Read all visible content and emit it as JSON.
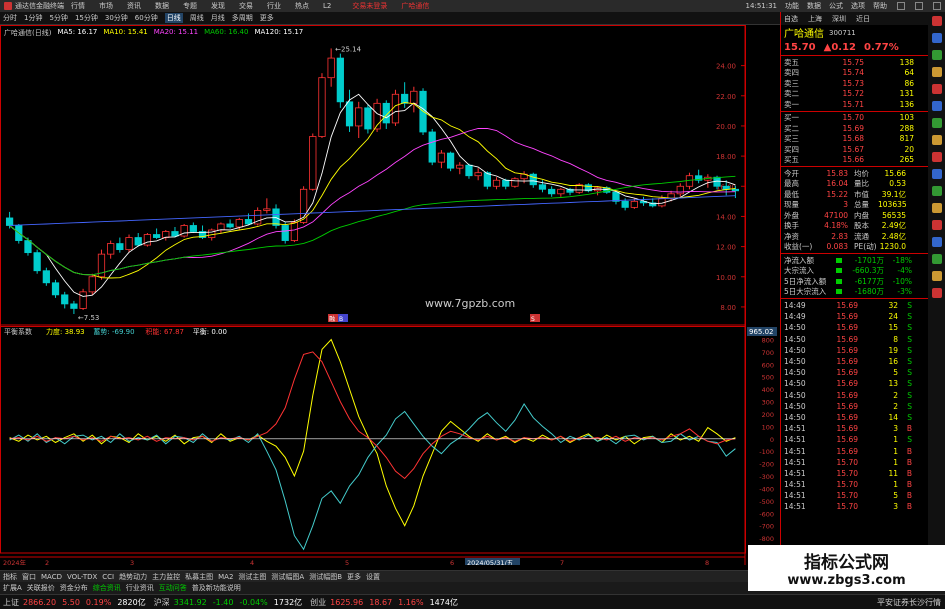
{
  "window": {
    "app_title": "通达信金融终端",
    "menus": [
      "行情",
      "市场",
      "资讯",
      "数据",
      "专题",
      "发现",
      "交易",
      "行业",
      "热点",
      "L2"
    ],
    "center_links": [
      "交易未登录",
      "广哈通信"
    ],
    "right_menus": [
      "功能",
      "数据",
      "公式",
      "选项",
      "帮助"
    ],
    "clock": "14:51:31"
  },
  "period_tabs": [
    "分时",
    "1分钟",
    "5分钟",
    "15分钟",
    "30分钟",
    "60分钟",
    "日线",
    "周线",
    "月线",
    "多周期",
    "更多"
  ],
  "active_period": "日线",
  "chart_header": {
    "stock": "广哈通信(日线)",
    "ma": [
      {
        "label": "MA5: 16.17",
        "color": "#ffffff"
      },
      {
        "label": "MA10: 15.41",
        "color": "#ffff00"
      },
      {
        "label": "MA20: 15.11",
        "color": "#ff44ff"
      },
      {
        "label": "MA60: 16.40",
        "color": "#00cc00"
      },
      {
        "label": "MA120: 15.17",
        "color": "#ffffff"
      }
    ],
    "high_label": "25.14",
    "low_label": "7.53",
    "site": "www.7gpzb.com"
  },
  "indicator_header": {
    "name": "平衡系数",
    "items": [
      {
        "label": "力度: 38.93",
        "color": "#ffff00"
      },
      {
        "label": "蓄势: -69.90",
        "color": "#44cccc"
      },
      {
        "label": "积能: 67.87",
        "color": "#ff3333"
      },
      {
        "label": "平衡: 0.00",
        "color": "#ffffff"
      }
    ],
    "cursor_value": "965.02"
  },
  "price_axis": [
    "24.00",
    "22.00",
    "20.00",
    "18.00",
    "16.00",
    "14.00",
    "12.00",
    "10.00",
    "8.00"
  ],
  "ind_axis": [
    "800",
    "700",
    "600",
    "500",
    "400",
    "300",
    "200",
    "100",
    "0",
    "-100",
    "-200",
    "-300",
    "-400",
    "-500",
    "-600",
    "-700",
    "-800",
    "-900"
  ],
  "date_axis": {
    "ticks": [
      "2024年",
      "2",
      "3",
      "4",
      "5",
      "6",
      "7",
      "8"
    ],
    "cursor": "2024/05/31/五"
  },
  "markers": [
    "融",
    "B",
    "S"
  ],
  "right_panel": {
    "header": [
      "自选",
      "上海",
      "深圳",
      "近日"
    ],
    "stock_name": "广哈通信",
    "stock_code": "300711",
    "price": "15.70",
    "change": "▲0.12",
    "pct": "0.77%",
    "asks": [
      {
        "l": "卖五",
        "p": "15.75",
        "v": "138"
      },
      {
        "l": "卖四",
        "p": "15.74",
        "v": "64"
      },
      {
        "l": "卖三",
        "p": "15.73",
        "v": "86"
      },
      {
        "l": "卖二",
        "p": "15.72",
        "v": "131"
      },
      {
        "l": "卖一",
        "p": "15.71",
        "v": "136"
      }
    ],
    "bids": [
      {
        "l": "买一",
        "p": "15.70",
        "v": "103"
      },
      {
        "l": "买二",
        "p": "15.69",
        "v": "288"
      },
      {
        "l": "买三",
        "p": "15.68",
        "v": "817"
      },
      {
        "l": "买四",
        "p": "15.67",
        "v": "20"
      },
      {
        "l": "买五",
        "p": "15.66",
        "v": "265"
      }
    ],
    "info": [
      {
        "k": "今开",
        "v": "15.83",
        "k2": "均价",
        "v2": "15.66"
      },
      {
        "k": "最高",
        "v": "16.04",
        "k2": "量比",
        "v2": "0.53"
      },
      {
        "k": "最低",
        "v": "15.22",
        "k2": "市值",
        "v2": "39.1亿"
      },
      {
        "k": "现量",
        "v": "3",
        "k2": "总量",
        "v2": "103635"
      },
      {
        "k": "外盘",
        "v": "47100",
        "k2": "内盘",
        "v2": "56535"
      },
      {
        "k": "换手",
        "v": "4.18%",
        "k2": "股本",
        "v2": "2.49亿"
      },
      {
        "k": "净资",
        "v": "2.83",
        "k2": "流通",
        "v2": "2.48亿"
      },
      {
        "k": "收益(一)",
        "v": "0.083",
        "k2": "PE(动)",
        "v2": "1230.0"
      }
    ],
    "flows": [
      {
        "k": "净流入额",
        "v": "-1701万",
        "p": "-18%"
      },
      {
        "k": "大宗流入",
        "v": "-660.3万",
        "p": "-4%"
      },
      {
        "k": "5日净流入额",
        "v": "-6177万",
        "p": "-10%"
      },
      {
        "k": "5日大宗流入",
        "v": "-1680万",
        "p": "-3%"
      }
    ],
    "ticks": [
      {
        "t": "14:49",
        "p": "15.69",
        "v": "32",
        "s": "S"
      },
      {
        "t": "14:49",
        "p": "15.69",
        "v": "24",
        "s": "S"
      },
      {
        "t": "14:50",
        "p": "15.69",
        "v": "15",
        "s": "S"
      },
      {
        "t": "14:50",
        "p": "15.69",
        "v": "8",
        "s": "S"
      },
      {
        "t": "14:50",
        "p": "15.69",
        "v": "19",
        "s": "S"
      },
      {
        "t": "14:50",
        "p": "15.69",
        "v": "16",
        "s": "S"
      },
      {
        "t": "14:50",
        "p": "15.69",
        "v": "5",
        "s": "S"
      },
      {
        "t": "14:50",
        "p": "15.69",
        "v": "13",
        "s": "S"
      },
      {
        "t": "14:50",
        "p": "15.69",
        "v": "2",
        "s": "S"
      },
      {
        "t": "14:50",
        "p": "15.69",
        "v": "2",
        "s": "S"
      },
      {
        "t": "14:50",
        "p": "15.69",
        "v": "14",
        "s": "S"
      },
      {
        "t": "14:51",
        "p": "15.69",
        "v": "3",
        "s": "B"
      },
      {
        "t": "14:51",
        "p": "15.69",
        "v": "1",
        "s": "S"
      },
      {
        "t": "14:51",
        "p": "15.69",
        "v": "1",
        "s": "B"
      },
      {
        "t": "14:51",
        "p": "15.70",
        "v": "1",
        "s": "B"
      },
      {
        "t": "14:51",
        "p": "15.70",
        "v": "11",
        "s": "B"
      },
      {
        "t": "14:51",
        "p": "15.70",
        "v": "1",
        "s": "B"
      },
      {
        "t": "14:51",
        "p": "15.70",
        "v": "5",
        "s": "B"
      },
      {
        "t": "14:51",
        "p": "15.70",
        "v": "3",
        "s": "B"
      }
    ]
  },
  "bottom_tabs": [
    "指标",
    "窗口",
    "MACD",
    "VOL-TDX",
    "CCI",
    "趋势动力",
    "主力监控",
    "私募主图",
    "MA2",
    "测试主图",
    "测试幅图A",
    "测试幅图B",
    "更多",
    "设置"
  ],
  "sub_tabs": [
    {
      "t": "扩展A",
      "g": false
    },
    {
      "t": "关联报价",
      "g": false
    },
    {
      "t": "资金分布",
      "g": false
    },
    {
      "t": "综合资讯",
      "g": true
    },
    {
      "t": "行业资讯",
      "g": false
    },
    {
      "t": "互动问答",
      "g": true
    },
    {
      "t": "普及新功能说明",
      "g": false
    }
  ],
  "status": [
    {
      "n": "上证",
      "v": "2866.20",
      "c": "5.50",
      "p": "0.19%",
      "a": "2820亿",
      "dir": "up"
    },
    {
      "n": "沪深",
      "v": "3341.92",
      "c": "-1.40",
      "p": "-0.04%",
      "a": "1732亿",
      "dir": "dn"
    },
    {
      "n": "创业",
      "v": "1625.96",
      "c": "18.67",
      "p": "1.16%",
      "a": "1474亿",
      "dir": "up"
    }
  ],
  "broker": "平安证券长沙行情",
  "watermark": {
    "a": "指标公式网",
    "b": "www.zbgs3.com"
  },
  "colors": {
    "up": "#ff3333",
    "down": "#00cccc",
    "ma5": "#ffffff",
    "ma10": "#ffff00",
    "ma20": "#ff44ff",
    "ma60": "#00cc00",
    "ma120": "#4466ff"
  },
  "chart_data": [
    {
      "type": "candlestick",
      "title": "广哈通信(日线)",
      "ylim": [
        7,
        25.5
      ],
      "ohlc": [
        [
          13.9,
          14.3,
          13.2,
          13.4
        ],
        [
          13.4,
          13.5,
          12.2,
          12.4
        ],
        [
          12.4,
          12.6,
          11.4,
          11.6
        ],
        [
          11.6,
          11.8,
          10.2,
          10.4
        ],
        [
          10.4,
          10.6,
          9.4,
          9.6
        ],
        [
          9.6,
          9.8,
          8.6,
          8.8
        ],
        [
          8.8,
          9,
          7.9,
          8.2
        ],
        [
          8.2,
          8.4,
          7.53,
          7.9
        ],
        [
          7.9,
          9.2,
          7.8,
          9
        ],
        [
          9,
          10.2,
          8.8,
          10
        ],
        [
          10,
          11.8,
          9.8,
          11.5
        ],
        [
          11.5,
          12.4,
          11.2,
          12.2
        ],
        [
          12.2,
          12.6,
          11.6,
          11.8
        ],
        [
          11.8,
          12.8,
          11.6,
          12.6
        ],
        [
          12.6,
          12.9,
          12,
          12.1
        ],
        [
          12.1,
          12.9,
          12,
          12.8
        ],
        [
          12.8,
          13.2,
          12.5,
          12.6
        ],
        [
          12.6,
          13.1,
          12.4,
          13
        ],
        [
          13,
          13.3,
          12.6,
          12.7
        ],
        [
          12.7,
          13.5,
          12.6,
          13.4
        ],
        [
          13.4,
          13.6,
          12.9,
          13
        ],
        [
          13,
          13.4,
          12.5,
          12.6
        ],
        [
          12.6,
          13.2,
          12.4,
          13.1
        ],
        [
          13.1,
          13.6,
          12.9,
          13.5
        ],
        [
          13.5,
          13.8,
          13.2,
          13.3
        ],
        [
          13.3,
          13.9,
          13.1,
          13.8
        ],
        [
          13.8,
          14.2,
          13.4,
          13.5
        ],
        [
          13.5,
          14.6,
          13.4,
          14.4
        ],
        [
          14.4,
          15.2,
          14.2,
          14.5
        ],
        [
          14.5,
          14.8,
          13.2,
          13.4
        ],
        [
          13.4,
          13.6,
          12.2,
          12.4
        ],
        [
          12.4,
          13.8,
          12.3,
          13.6
        ],
        [
          13.6,
          16,
          13.5,
          15.8
        ],
        [
          15.8,
          19.5,
          15.7,
          19.3
        ],
        [
          19.3,
          23.5,
          19.2,
          23.2
        ],
        [
          23.2,
          25.14,
          22.6,
          24.5
        ],
        [
          24.5,
          24.8,
          21.2,
          21.6
        ],
        [
          21.6,
          22.4,
          19.6,
          20
        ],
        [
          20,
          21.6,
          19.2,
          21.2
        ],
        [
          21.2,
          21.4,
          19.5,
          19.8
        ],
        [
          19.8,
          21.8,
          19.6,
          21.5
        ],
        [
          21.5,
          21.7,
          19.8,
          20.2
        ],
        [
          20.2,
          22.4,
          20,
          22.1
        ],
        [
          22.1,
          22.9,
          21.2,
          21.5
        ],
        [
          21.5,
          22.6,
          20.9,
          22.3
        ],
        [
          22.3,
          22.5,
          19.4,
          19.6
        ],
        [
          19.6,
          19.8,
          17.4,
          17.6
        ],
        [
          17.6,
          18.4,
          17.2,
          18.2
        ],
        [
          18.2,
          18.3,
          17,
          17.2
        ],
        [
          17.2,
          17.6,
          16.8,
          17.4
        ],
        [
          17.4,
          17.5,
          16.5,
          16.7
        ],
        [
          16.7,
          17.2,
          16.4,
          16.9
        ],
        [
          16.9,
          17,
          15.8,
          16
        ],
        [
          16,
          16.6,
          15.8,
          16.4
        ],
        [
          16.4,
          16.5,
          15.8,
          16
        ],
        [
          16,
          16.6,
          15.9,
          16.5
        ],
        [
          16.5,
          17,
          16.2,
          16.8
        ],
        [
          16.8,
          16.9,
          15.9,
          16.1
        ],
        [
          16.1,
          16.4,
          15.6,
          15.8
        ],
        [
          15.8,
          16,
          15.3,
          15.5
        ],
        [
          15.5,
          15.9,
          15.3,
          15.8
        ],
        [
          15.8,
          15.9,
          15.4,
          15.6
        ],
        [
          15.6,
          16.2,
          15.5,
          16.1
        ],
        [
          16.1,
          16.2,
          15.6,
          15.7
        ],
        [
          15.7,
          16,
          15.4,
          15.9
        ],
        [
          15.9,
          16,
          15.5,
          15.6
        ],
        [
          15.6,
          15.7,
          14.8,
          15
        ],
        [
          15,
          15.2,
          14.4,
          14.6
        ],
        [
          14.6,
          15.2,
          14.5,
          15
        ],
        [
          15,
          15.3,
          14.7,
          14.9
        ],
        [
          14.9,
          15.2,
          14.6,
          14.7
        ],
        [
          14.7,
          15.4,
          14.6,
          15.2
        ],
        [
          15.2,
          15.7,
          15,
          15.5
        ],
        [
          15.5,
          16.2,
          15.3,
          16
        ],
        [
          16,
          16.9,
          15.8,
          16.7
        ],
        [
          16.7,
          17.1,
          16.2,
          16.4
        ],
        [
          16.4,
          16.8,
          15.9,
          16.6
        ],
        [
          16.6,
          16.7,
          15.8,
          16
        ],
        [
          16,
          16.4,
          15.4,
          15.8
        ],
        [
          15.8,
          16.04,
          15.22,
          15.7
        ]
      ]
    },
    {
      "type": "line",
      "title": "平衡系数",
      "ylim": [
        -920,
        820
      ],
      "series": [
        {
          "name": "力度",
          "values": [
            10,
            -20,
            30,
            -10,
            20,
            -30,
            10,
            40,
            -20,
            30,
            -40,
            20,
            10,
            -30,
            40,
            -10,
            20,
            -20,
            30,
            -40,
            10,
            20,
            -30,
            40,
            -20,
            10,
            -10,
            30,
            -20,
            -60,
            -150,
            -300,
            -100,
            350,
            720,
            800,
            620,
            400,
            180,
            20,
            -120,
            -380,
            -560,
            -700,
            -540,
            -300,
            -120,
            60,
            140,
            80,
            20,
            -20,
            40,
            -10,
            20,
            -30,
            10,
            -20,
            30,
            -10,
            20,
            -30,
            10,
            40,
            -20,
            30,
            -10,
            20,
            -40,
            10,
            20,
            -30,
            40,
            -10,
            20,
            -20,
            90,
            40,
            -20,
            10
          ]
        },
        {
          "name": "蓄势",
          "values": [
            -10,
            30,
            -20,
            40,
            -30,
            10,
            -40,
            20,
            30,
            -10,
            20,
            -30,
            40,
            -20,
            10,
            -10,
            30,
            -40,
            20,
            10,
            -30,
            40,
            -20,
            10,
            -10,
            20,
            -30,
            40,
            -100,
            -250,
            -500,
            -780,
            -890,
            -700,
            -480,
            -420,
            -520,
            -380,
            -290,
            -150,
            -50,
            30,
            160,
            220,
            120,
            20,
            -60,
            -120,
            -40,
            10,
            80,
            160,
            210,
            130,
            60,
            150,
            280,
            170,
            100,
            40,
            -30,
            20,
            -10,
            30,
            -20,
            10,
            -40,
            20,
            30,
            -10,
            20,
            -30,
            -20,
            40,
            -10,
            20,
            -20,
            -30,
            -140,
            -80
          ]
        },
        {
          "name": "积能",
          "values": [
            0,
            10,
            -10,
            20,
            -20,
            10,
            0,
            20,
            -10,
            10,
            -20,
            20,
            0,
            10,
            -10,
            20,
            -20,
            10,
            0,
            10,
            -10,
            20,
            -20,
            10,
            0,
            10,
            -10,
            20,
            50,
            120,
            250,
            480,
            680,
            700,
            620,
            460,
            300,
            160,
            60,
            10,
            -60,
            -150,
            -260,
            -320,
            -240,
            -120,
            -40,
            20,
            60,
            40,
            10,
            -10,
            20,
            -10,
            10,
            -20,
            10,
            0,
            10,
            -10,
            20,
            -20,
            10,
            0,
            10,
            -10,
            20,
            -20,
            10,
            0,
            10,
            -10,
            20,
            40,
            80,
            20,
            -20,
            -40,
            -10,
            0
          ]
        },
        {
          "name": "平衡",
          "values": [
            0,
            0,
            0,
            0,
            0,
            0,
            0,
            0,
            0,
            0,
            0,
            0,
            0,
            0,
            0,
            0,
            0,
            0,
            0,
            0,
            0,
            0,
            0,
            0,
            0,
            0,
            0,
            0,
            0,
            0,
            0,
            0,
            0,
            0,
            0,
            0,
            0,
            0,
            0,
            0,
            0,
            0,
            0,
            0,
            0,
            0,
            0,
            0,
            0,
            0,
            0,
            0,
            0,
            0,
            0,
            0,
            0,
            0,
            0,
            0,
            0,
            0,
            0,
            0,
            0,
            0,
            0,
            0,
            0,
            0,
            0,
            0,
            0,
            0,
            0,
            0,
            0,
            0,
            0,
            0
          ]
        }
      ]
    }
  ]
}
